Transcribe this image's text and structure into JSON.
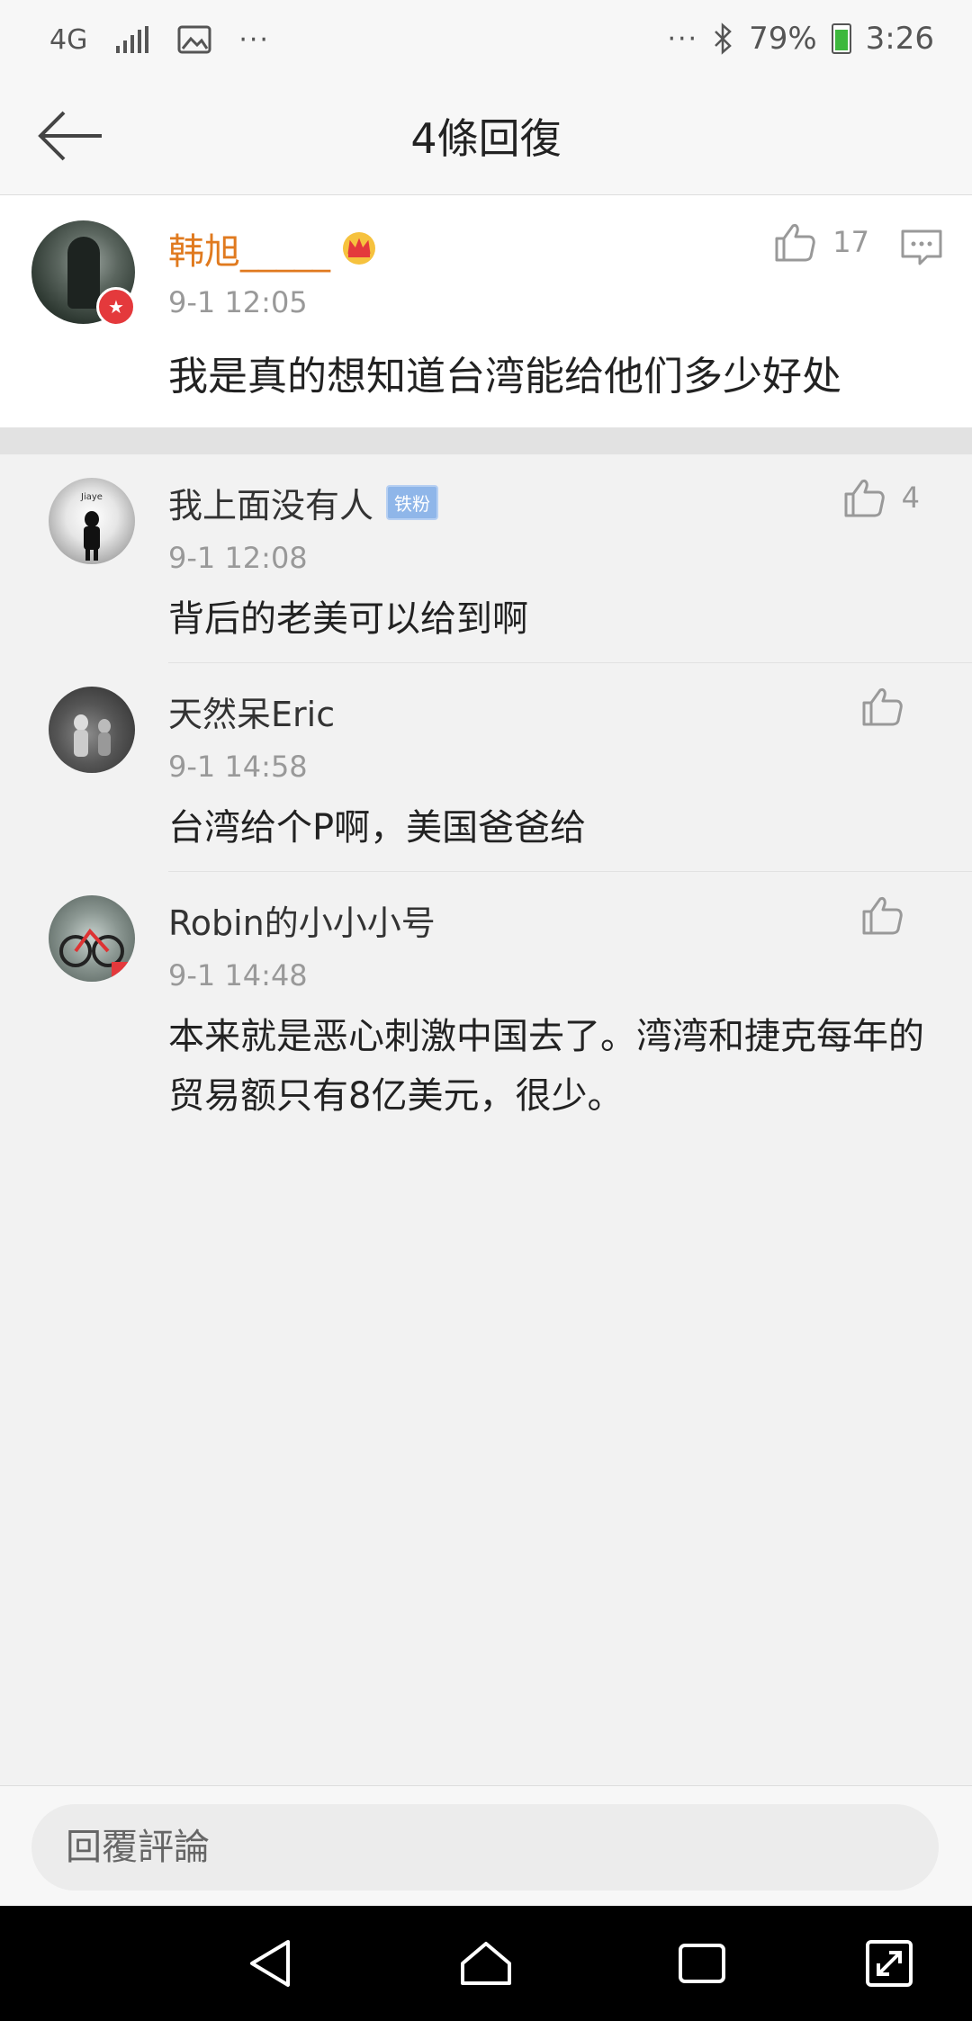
{
  "status_bar": {
    "network": "4G",
    "battery_percent": "79%",
    "time": "3:26",
    "icons": [
      "signal-icon",
      "image-icon",
      "more-icon",
      "bluetooth-icon",
      "battery-icon"
    ]
  },
  "header": {
    "title": "4條回復"
  },
  "main_comment": {
    "name": "韩旭_____",
    "time": "9-1 12:05",
    "text": "我是真的想知道台湾能给他们多少好处",
    "likes": "17"
  },
  "replies": [
    {
      "name": "我上面没有人",
      "badge": "铁粉",
      "time": "9-1 12:08",
      "text": "背后的老美可以给到啊",
      "likes": "4"
    },
    {
      "name": "天然呆Eric",
      "time": "9-1 14:58",
      "text": "台湾给个P啊，美国爸爸给",
      "likes": ""
    },
    {
      "name": "Robin的小小小号",
      "time": "9-1 14:48",
      "text": "本来就是恶心刺激中国去了。湾湾和捷克每年的贸易额只有8亿美元，很少。",
      "likes": ""
    }
  ],
  "bottom": {
    "placeholder": "回覆評論"
  },
  "colors": {
    "accent_name": "#e07a1f",
    "badge_red": "#e4393c",
    "badge_blue": "#8fb6e9"
  }
}
